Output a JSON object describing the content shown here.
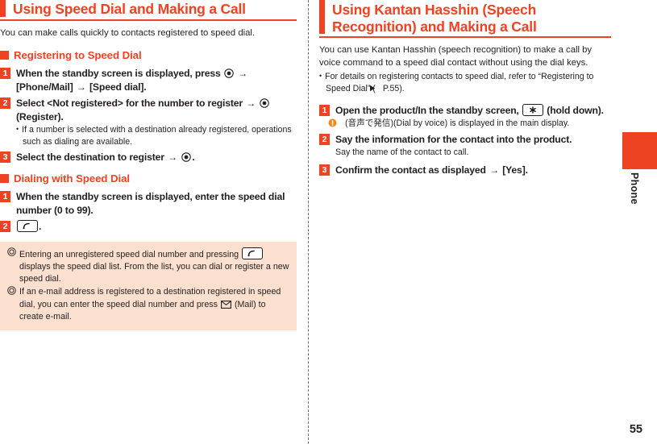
{
  "page": {
    "number": "55",
    "side_tab_label": "Phone",
    "accent_color": "#ee4323",
    "note_box_color": "#fbdfcf",
    "text_color": "#231f20"
  },
  "left_column": {
    "chapter_title": "Using Speed Dial and Making a Call",
    "intro": "You can make calls quickly to contacts registered to speed dial.",
    "sections": [
      {
        "heading": "Registering to Speed Dial",
        "steps": [
          {
            "number": "1",
            "title_part1": "When the standby screen is displayed, press",
            "icon1": "enter-key-icon",
            "arrow1": "→",
            "title_part2": "[Phone/Mail]",
            "arrow2": "→",
            "title_part3": "[Speed dial]."
          },
          {
            "number": "2",
            "title_part1": "Select <Not registered> for the number to register",
            "arrow1": "→",
            "icon1": "enter-key-icon",
            "title_part2": "(Register).",
            "sub": "If a number is selected with a destination already registered, operations such as dialing are available."
          },
          {
            "number": "3",
            "title_part1": "Select the destination to register",
            "arrow1": "→",
            "icon1": "enter-key-icon",
            "title_part2": "."
          }
        ]
      },
      {
        "heading": "Dialing with Speed Dial",
        "steps": [
          {
            "number": "1",
            "title_part1": "When the standby screen is displayed, enter the speed dial number (0 to 99)."
          },
          {
            "number": "2",
            "icon1": "call-key-icon",
            "title_part2": "."
          }
        ]
      }
    ],
    "notes": [
      {
        "bullet": "double-circle-icon",
        "text_part1": "Entering an unregistered speed dial number and pressing",
        "icon1": "call-key-icon",
        "text_part2": "displays the speed dial list. From the list, you can dial or register a new speed dial."
      },
      {
        "bullet": "double-circle-icon",
        "text_part1": "If an e-mail address is registered to a destination registered in speed dial, you can enter the speed dial number and press",
        "icon1": "mail-icon",
        "text_part2": "(Mail) to create e-mail."
      }
    ]
  },
  "right_column": {
    "chapter_title": "Using Kantan Hasshin (Speech Recognition) and Making a Call",
    "intro": "You can use Kantan Hasshin (speech recognition) to make a call by voice command to a speed dial contact without using the dial keys.",
    "bullet_note_part1": "For details on registering contacts to speed dial, refer to “Registering to Speed Dial” (",
    "bullet_note_ref_icon": "right-triangle-icon",
    "bullet_note_part2": "P.55).",
    "steps": [
      {
        "number": "1",
        "title_part1": "Open the product/In the standby screen,",
        "icon1": "asterisk-key-icon",
        "title_part2": "(hold down).",
        "sub_icon": "orange-info-icon",
        "sub": "(音声で発信)(Dial by voice) is displayed in the main display."
      },
      {
        "number": "2",
        "title_part1": "Say the information for the contact into the product.",
        "sub": "Say the name of the contact to call."
      },
      {
        "number": "3",
        "title_part1": "Confirm the contact as displayed",
        "arrow1": "→",
        "title_part2": "[Yes]."
      }
    ]
  }
}
